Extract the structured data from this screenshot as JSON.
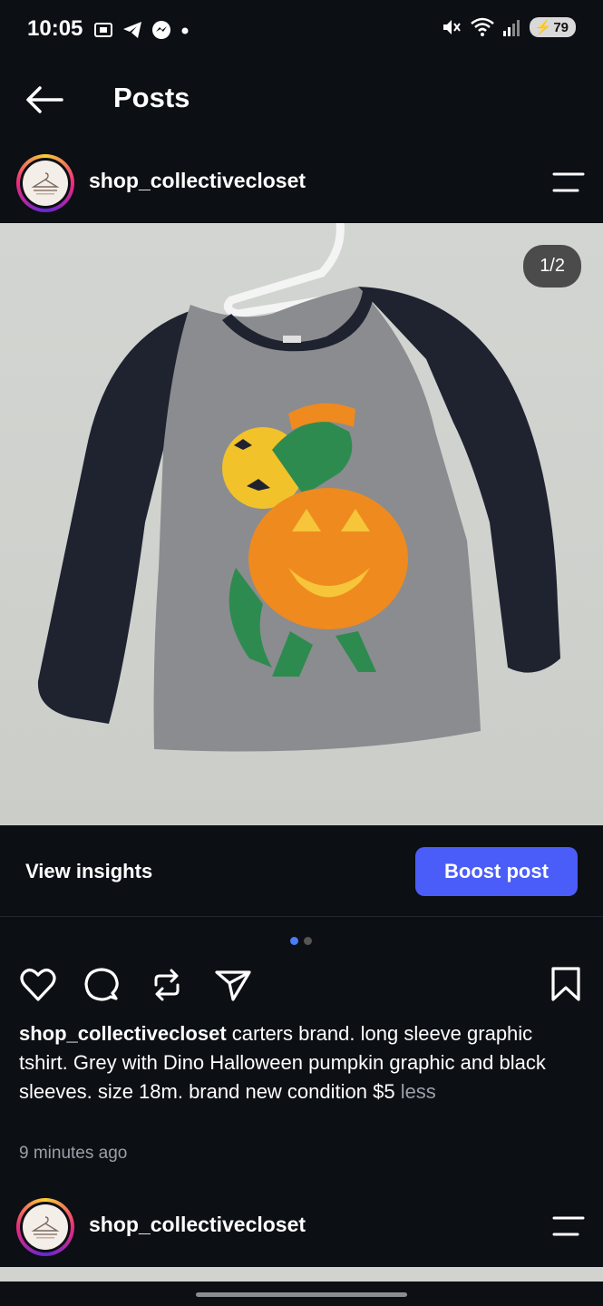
{
  "status_bar": {
    "time": "10:05",
    "battery": "79"
  },
  "topbar": {
    "title": "Posts"
  },
  "post": {
    "username": "shop_collectivecloset",
    "photo_counter": "1/2",
    "view_insights": "View insights",
    "boost_post": "Boost post",
    "caption_user": "shop_collectivecloset",
    "caption_text": " carters brand. long sleeve graphic tshirt. Grey with Dino Halloween pumpkin graphic and black sleeves. size 18m. brand new condition $5 ",
    "caption_less": "less",
    "timestamp": "9 minutes ago"
  },
  "next_post": {
    "username": "shop_collectivecloset"
  },
  "colors": {
    "accent": "#4a5df9",
    "background": "#0c0f14",
    "muted": "#9aa0a8"
  }
}
